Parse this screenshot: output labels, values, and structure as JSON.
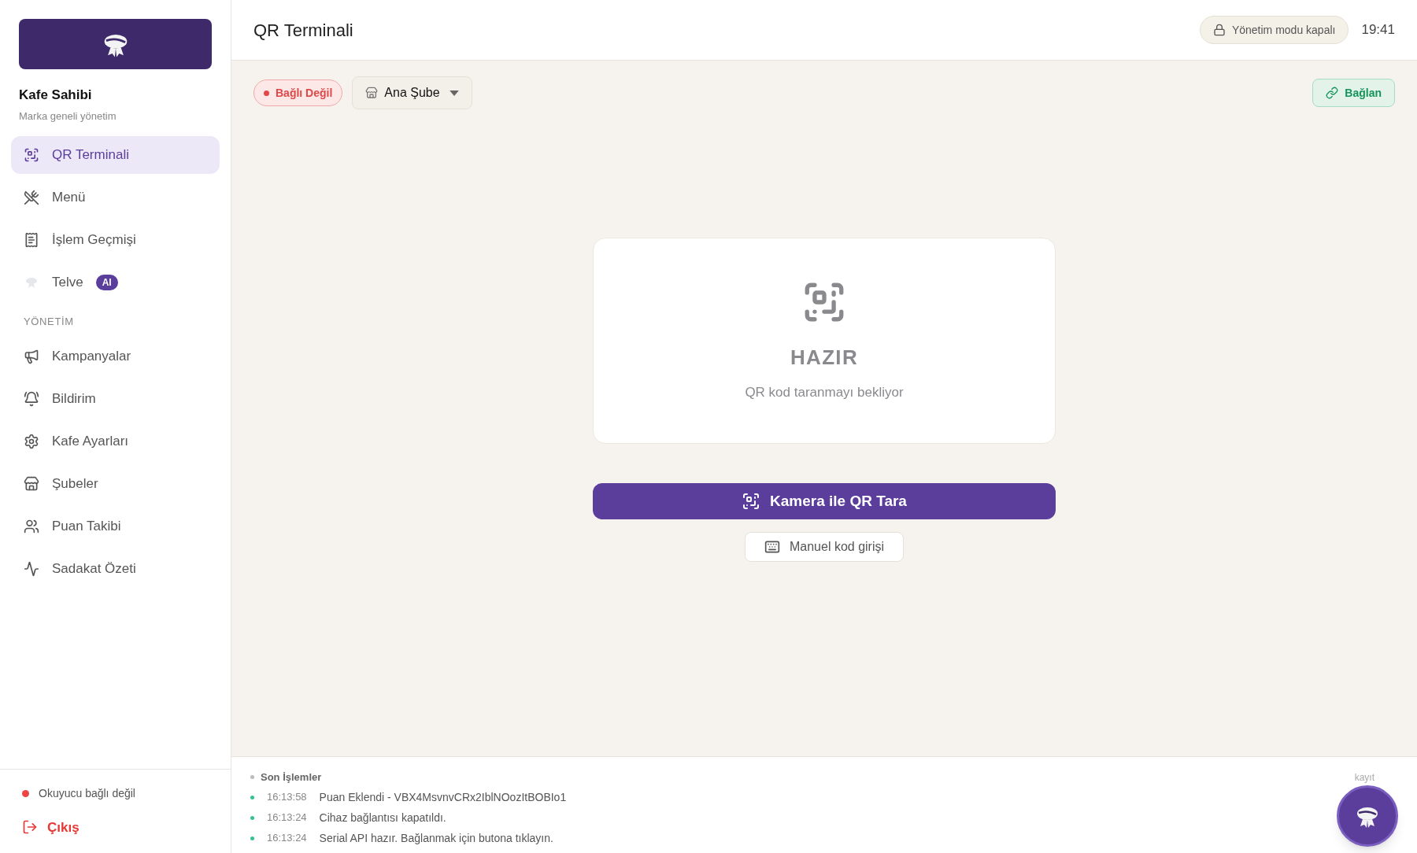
{
  "sidebar": {
    "brand": {
      "name": "Kafe Sahibi",
      "subtitle": "Marka geneli yönetim"
    },
    "sections": [
      {
        "items": [
          {
            "label": "QR Terminali",
            "selected": true
          },
          {
            "label": "Menü",
            "selected": false
          },
          {
            "label": "İşlem Geçmişi",
            "selected": false
          },
          {
            "label": "Telve",
            "badge": "AI",
            "selected": false
          }
        ]
      },
      {
        "title": "YÖNETİM",
        "items": [
          {
            "label": "Kampanyalar",
            "selected": false
          },
          {
            "label": "Bildirim",
            "selected": false
          },
          {
            "label": "Kafe Ayarları",
            "selected": false
          },
          {
            "label": "Şubeler",
            "selected": false
          },
          {
            "label": "Puan Takibi",
            "selected": false
          },
          {
            "label": "Sadakat Özeti",
            "selected": false
          }
        ]
      }
    ],
    "reader_status": {
      "label": "Okuyucu bağlı değil",
      "connected": false
    },
    "logout": "Çıkış"
  },
  "header": {
    "title": "QR Terminali",
    "admin_mode": {
      "label": "Yönetim modu kapalı",
      "on": false
    },
    "time": "19:41"
  },
  "toolbar": {
    "connection": {
      "label": "Bağlı Değil",
      "connected": false
    },
    "branch": "Ana Şube",
    "connect_button": "Bağlan"
  },
  "scanner": {
    "status": "HAZIR",
    "message": "QR kod taranmayı bekliyor",
    "scan_button": "Kamera ile QR Tara",
    "manual_button": "Manuel kod girişi"
  },
  "log": {
    "title": "Son İşlemler",
    "count": "kayıt",
    "entries": [
      {
        "time": "16:13:58",
        "text": "Puan Eklendi - VBX4MsvnvCRx2IblNOozItBOBIo1"
      },
      {
        "time": "16:13:24",
        "text": "Cihaz bağlantısı kapatıldı."
      },
      {
        "time": "16:13:24",
        "text": "Serial API hazır. Bağlanmak için butona tıklayın."
      }
    ]
  }
}
